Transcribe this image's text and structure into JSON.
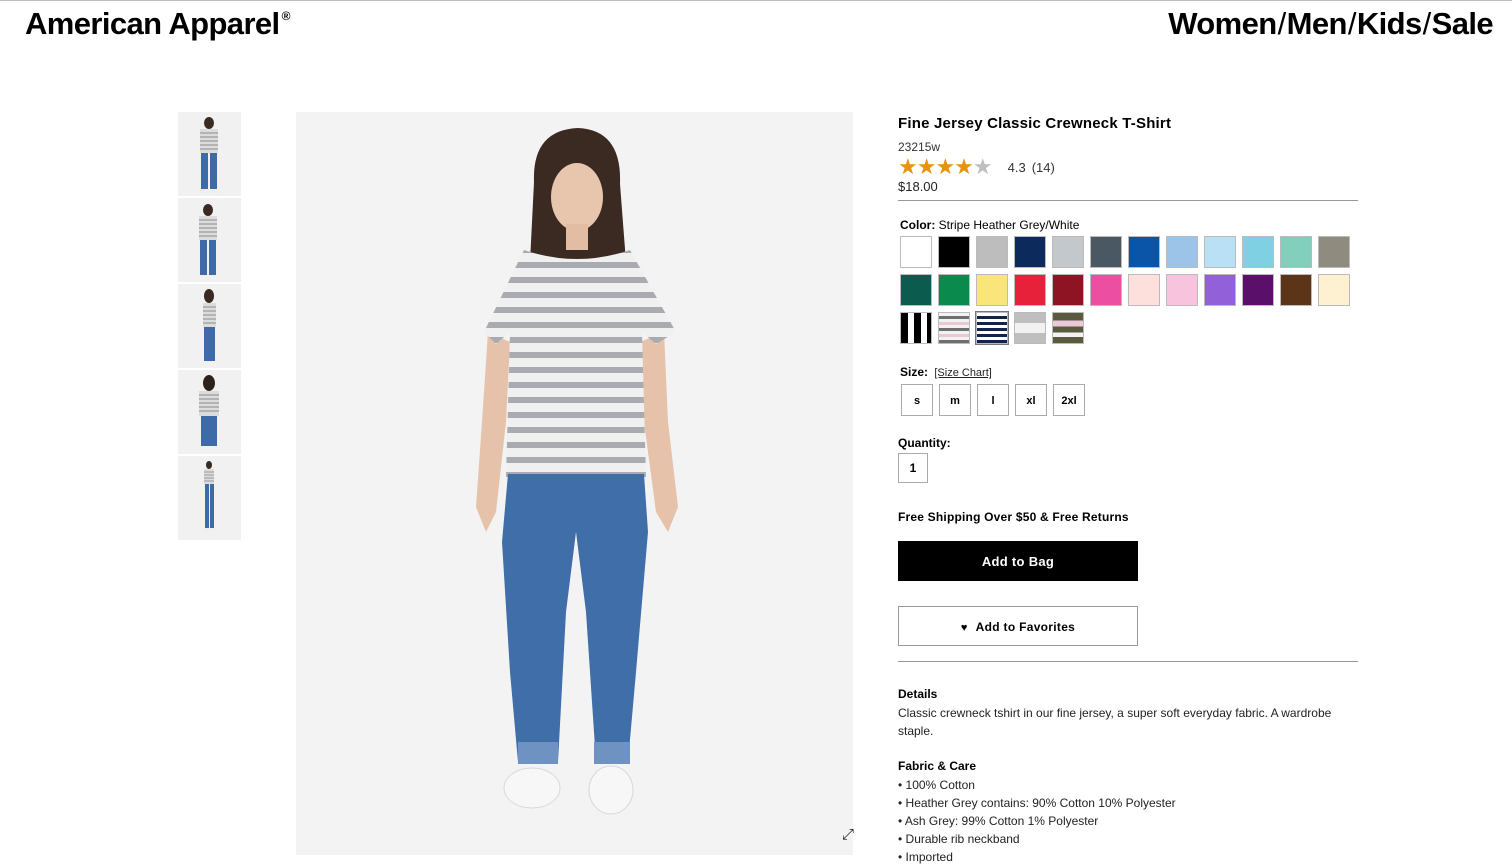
{
  "header": {
    "brand": "American Apparel",
    "brand_mark": "®",
    "nav": [
      "Women",
      "Men",
      "Kids",
      "Sale"
    ],
    "nav_sep": "/"
  },
  "product": {
    "title": "Fine Jersey Classic Crewneck T-Shirt",
    "sku": "23215w",
    "rating_value": "4.3",
    "rating_count": "(14)",
    "stars_filled": "★★★★",
    "stars_empty": "★",
    "price": "$18.00"
  },
  "color": {
    "label": "Color:",
    "selected": "Stripe Heather Grey/White",
    "swatches": [
      "#ffffff",
      "#000000",
      "#bdbdbd",
      "#0c2a5b",
      "#c3c8cc",
      "#4a5863",
      "#0a55a8",
      "#9cc3e8",
      "#b9e0f5",
      "#7fd0e3",
      "#82cfbc",
      "#8f8b7e",
      "#0b5c4e",
      "#0b8a4d",
      "#fae57a",
      "#e8213b",
      "#8e1424",
      "#ec4fa2",
      "#fde0dc",
      "#f8c3dc",
      "#9260d8",
      "#5a0f6b",
      "#5c3418",
      "#fdf1d2",
      "stripe-bw",
      "stripe-grey-pink",
      "stripe-navy",
      "stripe-heather",
      "stripe-olive-pink"
    ]
  },
  "size": {
    "label": "Size:",
    "chart_link": "[Size Chart]",
    "options": [
      "s",
      "m",
      "l",
      "xl",
      "2xl"
    ]
  },
  "quantity": {
    "label": "Quantity:",
    "value": "1"
  },
  "shipping_note": "Free Shipping Over $50 & Free Returns",
  "actions": {
    "add_to_bag": "Add to Bag",
    "add_to_favorites": "Add to Favorites"
  },
  "details": {
    "heading": "Details",
    "text": "Classic crewneck tshirt in our fine jersey, a super soft everyday fabric. A wardrobe staple."
  },
  "fabric": {
    "heading": "Fabric & Care",
    "items": [
      "• 100% Cotton",
      "• Heather Grey contains: 90% Cotton 10% Polyester",
      "• Ash Grey: 99% Cotton 1% Polyester",
      "• Durable rib neckband",
      "• Imported"
    ]
  },
  "icons": {
    "zoom": "expand-icon",
    "heart": "heart-icon"
  }
}
